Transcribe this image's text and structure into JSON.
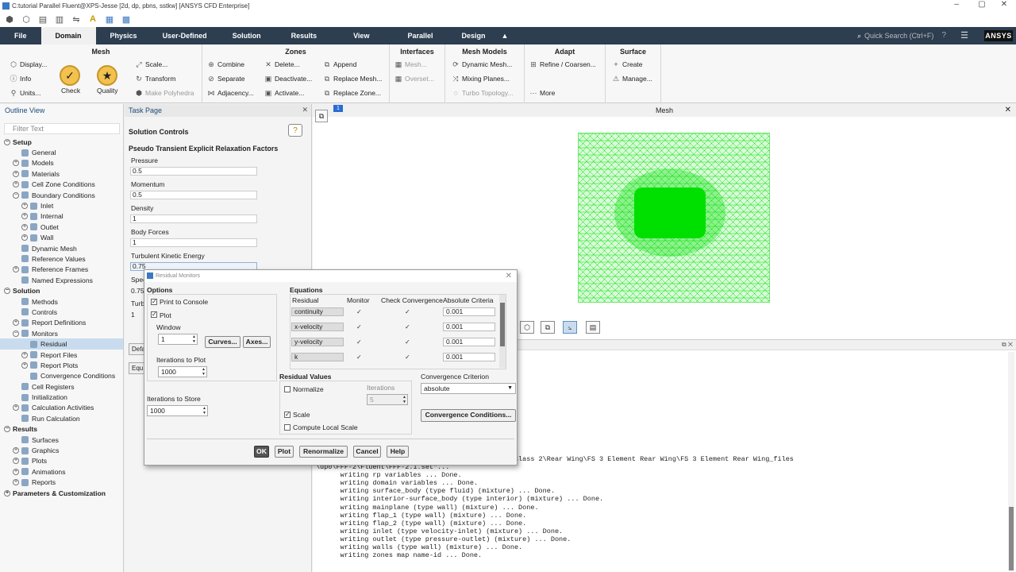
{
  "window": {
    "title": "C:tutorial Parallel Fluent@XPS-Jesse  [2d, dp, pbns, sstkw] [ANSYS CFD Enterprise]",
    "min": "–",
    "max": "▢",
    "close": "✕"
  },
  "ribbon_tabs": [
    "File",
    "Domain",
    "Physics",
    "User-Defined",
    "Solution",
    "Results",
    "View",
    "Parallel",
    "Design"
  ],
  "search_placeholder": "Quick Search (Ctrl+F)",
  "brand": "ANSYS",
  "ribbon": {
    "mesh": {
      "title": "Mesh",
      "display": "Display...",
      "info": "Info",
      "units": "Units...",
      "check": "Check",
      "quality": "Quality",
      "scale": "Scale...",
      "transform": "Transform",
      "make_polyhedra": "Make Polyhedra"
    },
    "zones": {
      "title": "Zones",
      "combine": "Combine",
      "separate": "Separate",
      "adjacency": "Adjacency...",
      "delete": "Delete...",
      "deactivate": "Deactivate...",
      "activate": "Activate...",
      "append": "Append",
      "replace_mesh": "Replace Mesh...",
      "replace_zone": "Replace Zone..."
    },
    "interfaces": {
      "title": "Interfaces",
      "mesh": "Mesh...",
      "overset": "Overset..."
    },
    "mesh_models": {
      "title": "Mesh Models",
      "dynamic": "Dynamic Mesh...",
      "mixing": "Mixing Planes...",
      "turbo": "Turbo Topology..."
    },
    "adapt": {
      "title": "Adapt",
      "refine": "Refine / Coarsen...",
      "more": "More"
    },
    "surface": {
      "title": "Surface",
      "create": "Create",
      "manage": "Manage..."
    }
  },
  "outline": {
    "title": "Outline View",
    "filter_placeholder": "Filter Text",
    "items": [
      {
        "label": "Setup",
        "level": 0,
        "exp": "−",
        "bold": true
      },
      {
        "label": "General",
        "level": 1,
        "exp": ""
      },
      {
        "label": "Models",
        "level": 1,
        "exp": "+"
      },
      {
        "label": "Materials",
        "level": 1,
        "exp": "+"
      },
      {
        "label": "Cell Zone Conditions",
        "level": 1,
        "exp": "+"
      },
      {
        "label": "Boundary Conditions",
        "level": 1,
        "exp": "−"
      },
      {
        "label": "Inlet",
        "level": 2,
        "exp": "+"
      },
      {
        "label": "Internal",
        "level": 2,
        "exp": "+"
      },
      {
        "label": "Outlet",
        "level": 2,
        "exp": "+"
      },
      {
        "label": "Wall",
        "level": 2,
        "exp": "+"
      },
      {
        "label": "Dynamic Mesh",
        "level": 1,
        "exp": ""
      },
      {
        "label": "Reference Values",
        "level": 1,
        "exp": ""
      },
      {
        "label": "Reference Frames",
        "level": 1,
        "exp": "+"
      },
      {
        "label": "Named Expressions",
        "level": 1,
        "exp": ""
      },
      {
        "label": "Solution",
        "level": 0,
        "exp": "−",
        "bold": true
      },
      {
        "label": "Methods",
        "level": 1,
        "exp": ""
      },
      {
        "label": "Controls",
        "level": 1,
        "exp": ""
      },
      {
        "label": "Report Definitions",
        "level": 1,
        "exp": "+"
      },
      {
        "label": "Monitors",
        "level": 1,
        "exp": "−"
      },
      {
        "label": "Residual",
        "level": 2,
        "exp": "",
        "selected": true
      },
      {
        "label": "Report Files",
        "level": 2,
        "exp": "+"
      },
      {
        "label": "Report Plots",
        "level": 2,
        "exp": "+"
      },
      {
        "label": "Convergence Conditions",
        "level": 2,
        "exp": ""
      },
      {
        "label": "Cell Registers",
        "level": 1,
        "exp": ""
      },
      {
        "label": "Initialization",
        "level": 1,
        "exp": ""
      },
      {
        "label": "Calculation Activities",
        "level": 1,
        "exp": "+"
      },
      {
        "label": "Run Calculation",
        "level": 1,
        "exp": ""
      },
      {
        "label": "Results",
        "level": 0,
        "exp": "−",
        "bold": true
      },
      {
        "label": "Surfaces",
        "level": 1,
        "exp": ""
      },
      {
        "label": "Graphics",
        "level": 1,
        "exp": "+"
      },
      {
        "label": "Plots",
        "level": 1,
        "exp": "+"
      },
      {
        "label": "Animations",
        "level": 1,
        "exp": "+"
      },
      {
        "label": "Reports",
        "level": 1,
        "exp": "+"
      },
      {
        "label": "Parameters & Customization",
        "level": 0,
        "exp": "+",
        "bold": true
      }
    ]
  },
  "task_page": {
    "title": "Task Page",
    "section": "Solution Controls",
    "subsection": "Pseudo Transient Explicit Relaxation Factors",
    "fields": [
      {
        "label": "Pressure",
        "value": "0.5"
      },
      {
        "label": "Momentum",
        "value": "0.5"
      },
      {
        "label": "Density",
        "value": "1"
      },
      {
        "label": "Body Forces",
        "value": "1"
      },
      {
        "label": "Turbulent Kinetic Energy",
        "value": "0.75"
      }
    ],
    "partial_labels": [
      "Spec",
      "0.75",
      "Turb",
      "1"
    ],
    "buttons": [
      "Defa",
      "Equ"
    ]
  },
  "graphics": {
    "title": "Mesh",
    "close": "✕"
  },
  "dialog": {
    "title": "Residual Monitors",
    "options_title": "Options",
    "print_to_console": "Print to Console",
    "plot": "Plot",
    "window_label": "Window",
    "window_value": "1",
    "curves_btn": "Curves...",
    "axes_btn": "Axes...",
    "iter_plot_label": "Iterations to Plot",
    "iter_plot_value": "1000",
    "iter_store_label": "Iterations to Store",
    "iter_store_value": "1000",
    "equations_title": "Equations",
    "col_residual": "Residual",
    "col_monitor": "Monitor",
    "col_check": "Check Convergence",
    "col_criteria": "Absolute Criteria",
    "equations": [
      {
        "name": "continuity",
        "criteria": "0.001"
      },
      {
        "name": "x-velocity",
        "criteria": "0.001"
      },
      {
        "name": "y-velocity",
        "criteria": "0.001"
      },
      {
        "name": "k",
        "criteria": "0.001"
      }
    ],
    "residual_values_title": "Residual Values",
    "normalize": "Normalize",
    "iterations_label": "Iterations",
    "iterations_value": "5",
    "scale": "Scale",
    "compute_local_scale": "Compute Local Scale",
    "convergence_criterion_label": "Convergence Criterion",
    "convergence_criterion_value": "absolute",
    "convergence_conditions_btn": "Convergence Conditions...",
    "ok": "OK",
    "plot_btn": "Plot",
    "renormalize": "Renormalize",
    "cancel": "Cancel",
    "help": "Help"
  },
  "console": {
    "text": "cuments\\University Of Manchester\\Formula Student\\Class 2\\Rear Wing\\FS 3 Element Rear Wing\\FS 3 Element Rear Wing_files\n\\dp0\\FFF-2\\Fluent\\FFF-2.1.set\"...\n      writing rp variables ... Done.\n      writing domain variables ... Done.\n      writing surface_body (type fluid) (mixture) ... Done.\n      writing interior-surface_body (type interior) (mixture) ... Done.\n      writing mainplane (type wall) (mixture) ... Done.\n      writing flap_1 (type wall) (mixture) ... Done.\n      writing flap_2 (type wall) (mixture) ... Done.\n      writing inlet (type velocity-inlet) (mixture) ... Done.\n      writing outlet (type pressure-outlet) (mixture) ... Done.\n      writing walls (type wall) (mixture) ... Done.\n      writing zones map name-id ... Done."
  },
  "colors": {
    "ribbon_bar": "#2c3e50",
    "mesh": "#00e000",
    "selection": "#c9dcef"
  }
}
